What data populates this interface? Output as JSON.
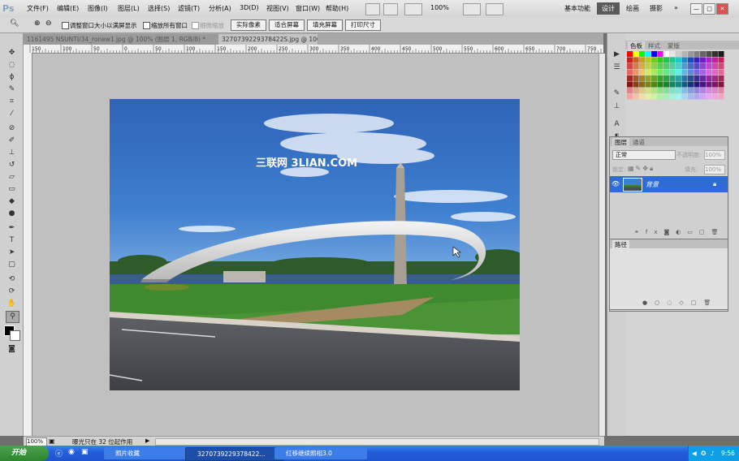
{
  "app": {
    "logo": "Ps"
  },
  "menu": [
    "文件(F)",
    "编辑(E)",
    "图像(I)",
    "图层(L)",
    "选择(S)",
    "滤镜(T)",
    "分析(A)",
    "3D(D)",
    "视图(V)",
    "窗口(W)",
    "帮助(H)"
  ],
  "menubar": {
    "zoom": "100%"
  },
  "workspaces": {
    "basic": "基本功能",
    "design": "设计",
    "paint": "绘画",
    "photo": "摄影"
  },
  "window_controls": {
    "minimize": "—",
    "restore": "□",
    "close": "✕"
  },
  "options": {
    "resize_windows": "调整窗口大小以满屏显示",
    "zoom_all": "缩放所有窗口",
    "scrubby": "细微缩放",
    "actual_pixels": "实际像素",
    "fit_screen": "适合屏幕",
    "fill_screen": "填充屏幕",
    "print_size": "打印尺寸"
  },
  "tabs": [
    {
      "label": "1161495 NSUNTI/34_ronew1.jpg @ 100% (图层 1, RGB/8) *",
      "active": false
    },
    {
      "label": "3270739229378422S.jpg @ 100%(RGB/8)",
      "active": true
    }
  ],
  "ruler": {
    "marks": [
      "150",
      "100",
      "50",
      "0",
      "50",
      "100",
      "150",
      "200",
      "250",
      "300",
      "350",
      "400",
      "450",
      "500",
      "550",
      "600",
      "650",
      "700",
      "750"
    ]
  },
  "photo": {
    "watermark": "三联网 3LIAN.COM"
  },
  "status": {
    "zoom": "100%",
    "info": "曝光只在 32 位起作用"
  },
  "panels": {
    "swatch_tabs": [
      "色板",
      "样式",
      "蒙版"
    ],
    "layers_tabs": [
      "图层",
      "通道"
    ],
    "blend_mode": "正常",
    "opacity_label": "不透明度:",
    "opacity_value": "100%",
    "lock_label": "锁定:",
    "fill_label": "填充:",
    "fill_value": "100%",
    "layer_name": "背景",
    "paths_tab": "路径"
  },
  "colors": {
    "accent": "#2f6bd4",
    "ws_active": "#5a5a5a",
    "taskbar": "#245edb",
    "start": "#2d862d"
  },
  "taskbar": {
    "start": "开始",
    "items": [
      "照片收藏",
      "3270739229378422...",
      "红移继续照相3.0"
    ],
    "clock": "9:56"
  }
}
